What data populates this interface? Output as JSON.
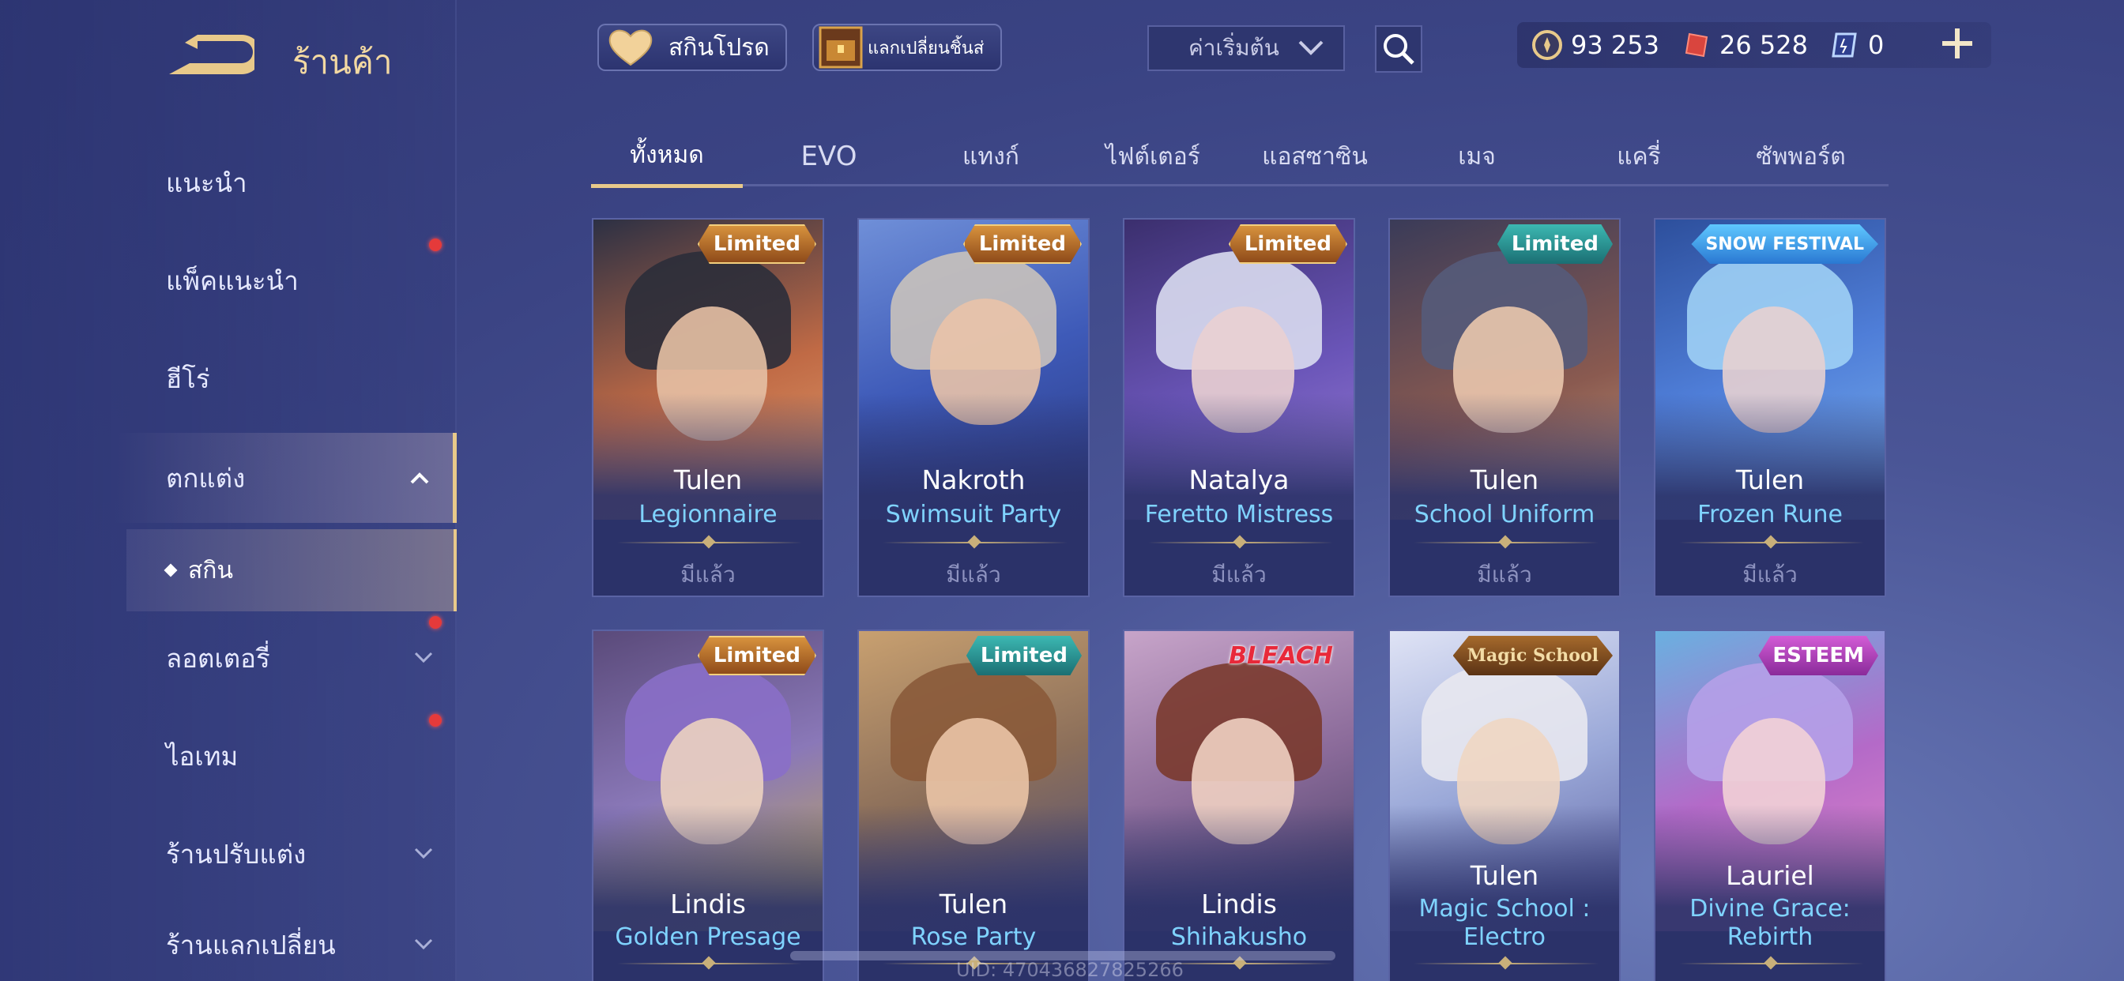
{
  "header": {
    "title": "ร้านค้า",
    "favorites_label": "สกินโปรด",
    "exchange_label": "แลกเปลี่ยนชิ้นส่",
    "sort_value": "ค่าเริ่มต้น"
  },
  "currency": {
    "gold": "93 253",
    "voucher": "26 528",
    "diamond": "0"
  },
  "sidebar": {
    "items": [
      {
        "label": "แนะนำ"
      },
      {
        "label": "แพ็คแนะนำ"
      },
      {
        "label": "ฮีโร่"
      },
      {
        "label": "ตกแต่ง"
      },
      {
        "label": "สกิน"
      },
      {
        "label": "ลอตเตอรี่"
      },
      {
        "label": "ไอเทม"
      },
      {
        "label": "ร้านปรับแต่ง"
      },
      {
        "label": "ร้านแลกเปลี่ยน"
      }
    ]
  },
  "tabs": [
    {
      "label": "ทั้งหมด"
    },
    {
      "label": "EVO"
    },
    {
      "label": "แทงก์"
    },
    {
      "label": "ไฟต์เตอร์"
    },
    {
      "label": "แอสซาซิน"
    },
    {
      "label": "เมจ"
    },
    {
      "label": "แครี่"
    },
    {
      "label": "ซัพพอร์ต"
    }
  ],
  "cards": [
    {
      "hero": "Tulen",
      "skin": "Legionnaire",
      "status": "มีแล้ว",
      "badge": "Limited"
    },
    {
      "hero": "Nakroth",
      "skin": "Swimsuit Party",
      "status": "มีแล้ว",
      "badge": "Limited"
    },
    {
      "hero": "Natalya",
      "skin": "Feretto Mistress",
      "status": "มีแล้ว",
      "badge": "Limited"
    },
    {
      "hero": "Tulen",
      "skin": "School Uniform",
      "status": "มีแล้ว",
      "badge": "Limited"
    },
    {
      "hero": "Tulen",
      "skin": "Frozen Rune",
      "status": "มีแล้ว",
      "badge": "SNOW FESTIVAL"
    },
    {
      "hero": "Lindis",
      "skin": "Golden Presage",
      "badge": "Limited"
    },
    {
      "hero": "Tulen",
      "skin": "Rose Party",
      "badge": "Limited"
    },
    {
      "hero": "Lindis",
      "skin": "Shihakusho",
      "badge": "BLEACH"
    },
    {
      "hero": "Tulen",
      "skin": "Magic School : Electro",
      "badge": "Magic School"
    },
    {
      "hero": "Lauriel",
      "skin": "Divine Grace: Rebirth",
      "badge": "ESTEEM"
    }
  ],
  "footer": {
    "uid": "UID: 470436827825266"
  },
  "colors": {
    "accent": "#e8c98a",
    "skin_name": "#7fd3ff",
    "background": "#3a4383"
  }
}
